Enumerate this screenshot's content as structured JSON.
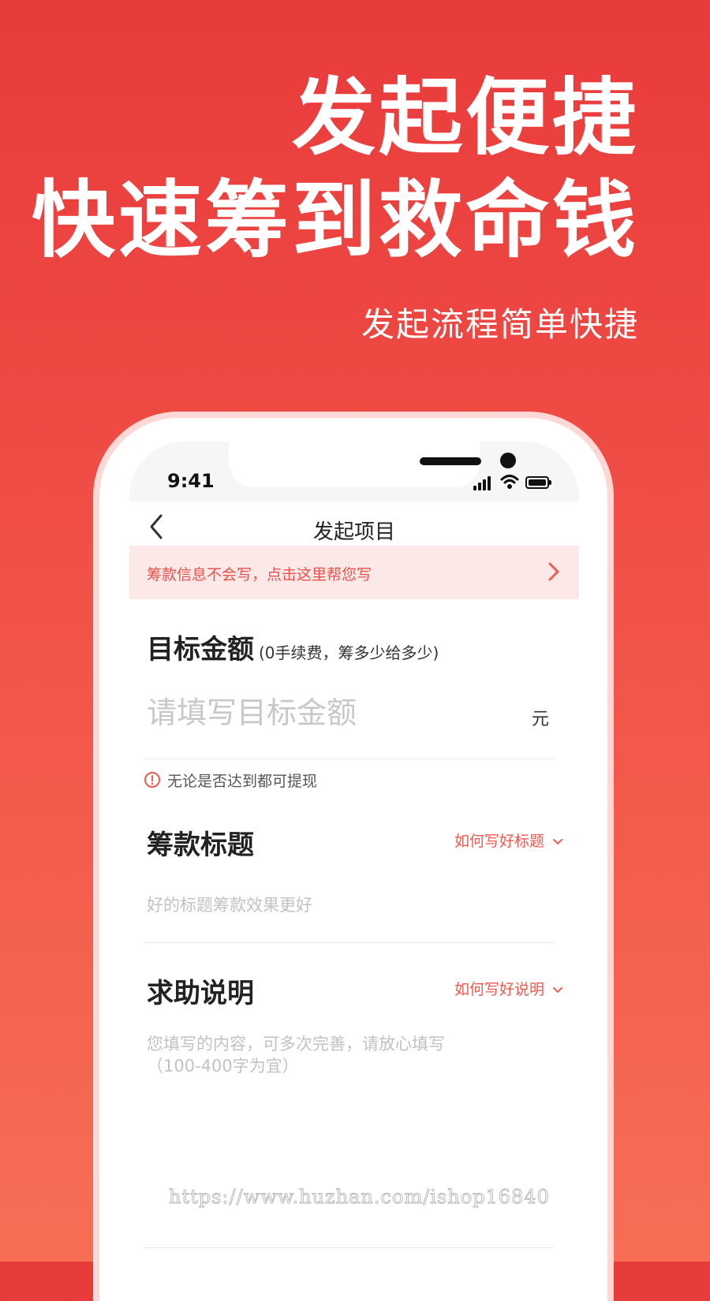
{
  "hero": {
    "line1": "发起便捷",
    "line2": "快速筹到救命钱",
    "subtitle": "发起流程简单快捷"
  },
  "status_bar": {
    "time": "9:41"
  },
  "nav": {
    "title": "发起项目"
  },
  "banner": {
    "text": "筹款信息不会写，点击这里帮您写"
  },
  "target_amount": {
    "title": "目标金额",
    "note": "(0手续费，筹多少给多少)",
    "placeholder": "请填写目标金额",
    "unit": "元",
    "tip": "无论是否达到都可提现"
  },
  "fund_title": {
    "title": "筹款标题",
    "help_link": "如何写好标题",
    "placeholder": "好的标题筹款效果更好"
  },
  "help_description": {
    "title": "求助说明",
    "help_link": "如何写好说明",
    "placeholder": "您填写的内容，可多次完善，请放心填写\n（100-400字为宜）"
  },
  "watermark": "https://www.huzhan.com/ishop16840",
  "colors": {
    "brand_red": "#e83b3b",
    "link_red": "#ef5a52",
    "banner_bg": "#fde8e8"
  }
}
